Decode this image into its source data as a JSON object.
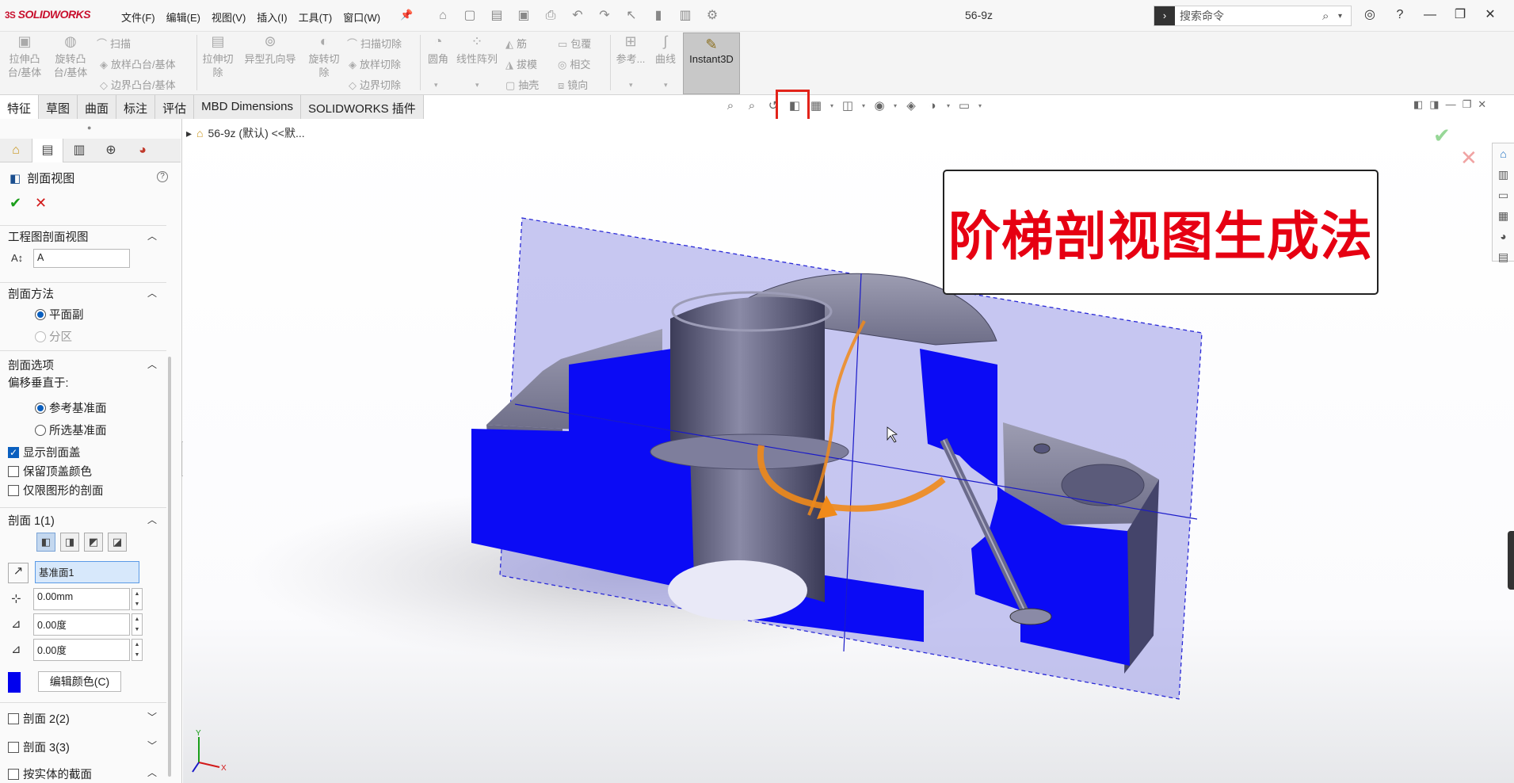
{
  "app": {
    "logo": "SOLIDWORKS",
    "logo_mark": "3S",
    "menus": [
      "文件(F)",
      "编辑(E)",
      "视图(V)",
      "插入(I)",
      "工具(T)",
      "窗口(W)"
    ],
    "document_title": "56-9z",
    "search_placeholder": "搜索命令"
  },
  "ribbon": {
    "big_buttons": [
      {
        "label": "拉伸凸台/基体",
        "icon": "extrude-boss-icon"
      },
      {
        "label": "旋转凸台/基体",
        "icon": "revolve-boss-icon"
      },
      {
        "label": "拉伸切除",
        "icon": "extrude-cut-icon"
      },
      {
        "label": "异型孔向导",
        "icon": "hole-wizard-icon"
      },
      {
        "label": "旋转切除",
        "icon": "revolve-cut-icon"
      },
      {
        "label": "圆角",
        "icon": "fillet-icon"
      },
      {
        "label": "线性阵列",
        "icon": "linear-pattern-icon"
      },
      {
        "label": "参考...",
        "icon": "reference-geometry-icon"
      },
      {
        "label": "曲线",
        "icon": "curves-icon"
      }
    ],
    "small_group1": [
      "扫描",
      "放样凸台/基体",
      "边界凸台/基体"
    ],
    "small_group2": [
      "扫描切除",
      "放样切除",
      "边界切除"
    ],
    "small_group3": [
      "筋",
      "拔模",
      "抽壳"
    ],
    "small_group4": [
      "包覆",
      "相交",
      "镜向"
    ],
    "instant3d": "Instant3D"
  },
  "tabs": [
    "特征",
    "草图",
    "曲面",
    "标注",
    "评估",
    "MBD Dimensions",
    "SOLIDWORKS 插件"
  ],
  "active_tab": "特征",
  "property_manager": {
    "title": "剖面视图",
    "section_drawing": {
      "header": "工程图剖面视图",
      "label_value": "A"
    },
    "method": {
      "header": "剖面方法",
      "options": [
        "平面副",
        "分区"
      ],
      "selected": "平面副"
    },
    "options": {
      "header": "剖面选项",
      "offset_label": "偏移垂直于:",
      "radios": [
        "参考基准面",
        "所选基准面"
      ],
      "selected": "参考基准面",
      "checkboxes": [
        {
          "label": "显示剖面盖",
          "checked": true
        },
        {
          "label": "保留顶盖颜色",
          "checked": false
        },
        {
          "label": "仅限图形的剖面",
          "checked": false
        }
      ]
    },
    "section1": {
      "header": "剖面 1(1)",
      "plane": "基准面1",
      "offset": "0.00mm",
      "angle_x": "0.00度",
      "angle_y": "0.00度",
      "edit_color": "编辑颜色(C)",
      "cap_color": "#0000ee"
    },
    "section2": "剖面 2(2)",
    "section3": "剖面 3(3)",
    "section_by_body": "按实体的截面"
  },
  "viewport": {
    "tree_crumb": "56-9z (默认) <<默...",
    "caption": "阶梯剖视图生成法",
    "triad_axes": [
      "Y",
      "X"
    ],
    "section_color": "#0b0bf5",
    "plane_color": "#9999e6"
  }
}
